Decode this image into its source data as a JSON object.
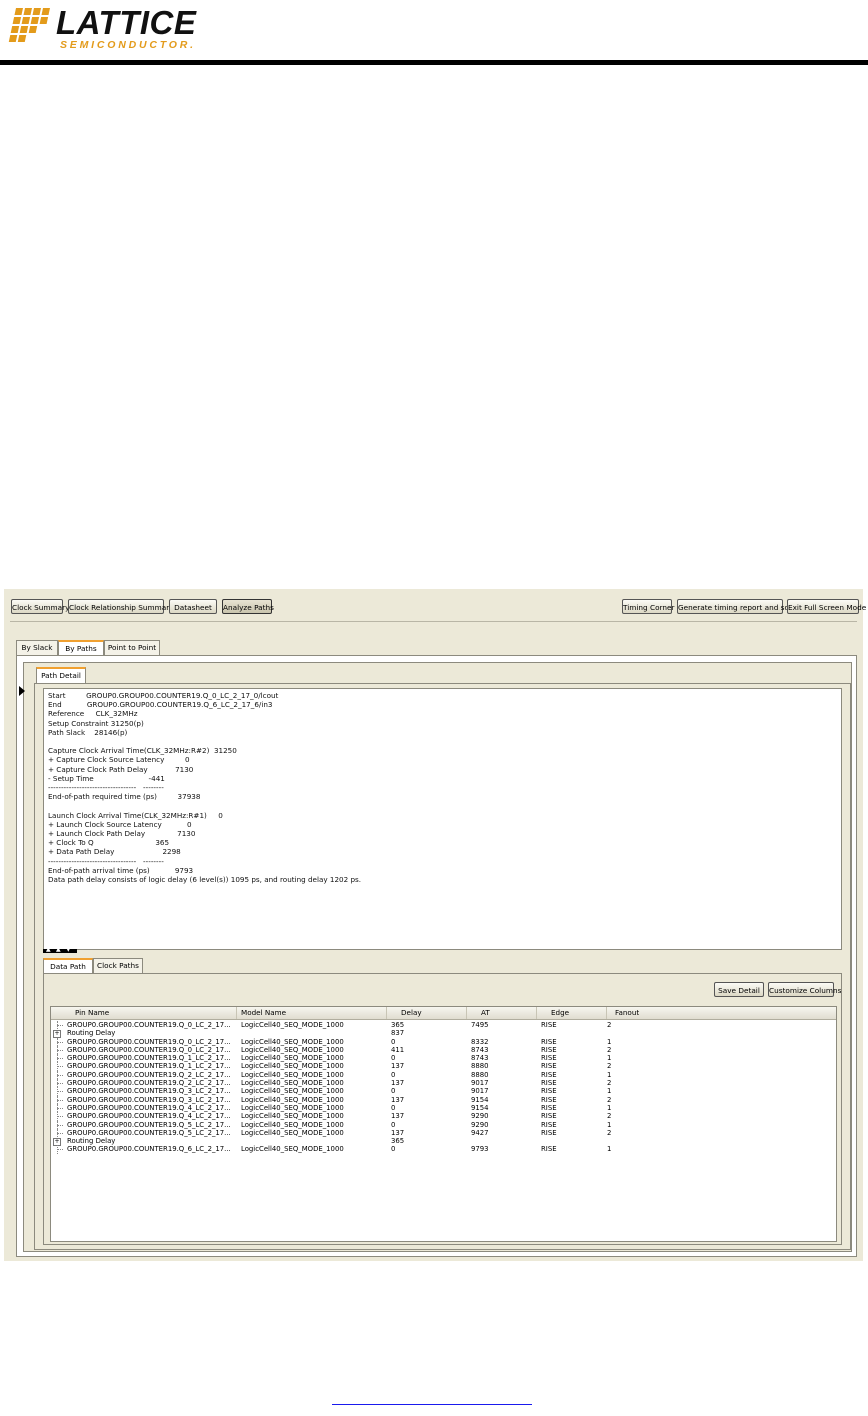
{
  "logo": {
    "word": "LATTICE",
    "sub": "SEMICONDUCTOR."
  },
  "toolbar": {
    "clock_summary": "Clock Summary",
    "clock_relationship_summary": "Clock Relationship Summary",
    "datasheet": "Datasheet",
    "analyze_paths": "Analyze Paths",
    "timing_corner": "Timing Corner",
    "generate_report": "Generate timing report and sdf",
    "exit_full_screen": "Exit Full Screen Mode"
  },
  "tabs": {
    "by_slack": "By Slack",
    "by_paths": "By Paths",
    "point_to_point": "Point to Point"
  },
  "path_detail_tab": "Path Detail",
  "detail": {
    "start_label": "Start",
    "start_value": "GROUP0.GROUP00.COUNTER19.Q_0_LC_2_17_0/lcout",
    "end_label": "End",
    "end_value": "GROUP0.GROUP00.COUNTER19.Q_6_LC_2_17_6/in3",
    "reference_label": "Reference",
    "reference_value": "CLK_32MHz",
    "setup_constraint": "Setup Constraint 31250(p)",
    "path_slack_label": "Path Slack",
    "path_slack_value": "28146(p)",
    "capture_arrival_label": "Capture Clock Arrival Time(CLK_32MHz:R#2)",
    "capture_arrival_value": "31250",
    "capture_source_latency_label": "+ Capture Clock Source Latency",
    "capture_source_latency_value": "0",
    "capture_path_delay_label": "+ Capture Clock Path Delay",
    "capture_path_delay_value": "7130",
    "setup_time_label": "- Setup Time",
    "setup_time_value": "-441",
    "dashes_a": "----------------------------------",
    "dashes_b": "--------",
    "required_time_label": "End-of-path required time (ps)",
    "required_time_value": "37938",
    "launch_arrival_label": "Launch Clock Arrival Time(CLK_32MHz:R#1)",
    "launch_arrival_value": "0",
    "launch_source_latency_label": "+ Launch Clock Source Latency",
    "launch_source_latency_value": "0",
    "launch_path_delay_label": "+ Launch Clock Path Delay",
    "launch_path_delay_value": "7130",
    "clock_to_q_label": "+ Clock To Q",
    "clock_to_q_value": "365",
    "data_path_delay_label": "+ Data Path Delay",
    "data_path_delay_value": "2298",
    "arrival_time_label": "End-of-path arrival time (ps)",
    "arrival_time_value": "9793",
    "summary": "Data path delay consists of logic delay (6 level(s)) 1095 ps, and routing delay 1202 ps."
  },
  "tabs2": {
    "data_path": "Data Path",
    "clock_paths": "Clock Paths"
  },
  "actions": {
    "save_detail": "Save Detail",
    "customize_columns": "Customize Columns"
  },
  "table": {
    "columns": [
      "Pin Name",
      "Model Name",
      "Delay",
      "AT",
      "Edge",
      "Fanout"
    ],
    "rows": [
      {
        "pin": "GROUP0.GROUP00.COUNTER19.Q_0_LC_2_17...",
        "model": "LogicCell40_SEQ_MODE_1000",
        "delay": "365",
        "at": "7495",
        "edge": "RISE",
        "fanout": "2",
        "expandable": false
      },
      {
        "pin": "Routing Delay",
        "model": "",
        "delay": "837",
        "at": "",
        "edge": "",
        "fanout": "",
        "expandable": true
      },
      {
        "pin": "GROUP0.GROUP00.COUNTER19.Q_0_LC_2_17...",
        "model": "LogicCell40_SEQ_MODE_1000",
        "delay": "0",
        "at": "8332",
        "edge": "RISE",
        "fanout": "1",
        "expandable": false
      },
      {
        "pin": "GROUP0.GROUP00.COUNTER19.Q_0_LC_2_17...",
        "model": "LogicCell40_SEQ_MODE_1000",
        "delay": "411",
        "at": "8743",
        "edge": "RISE",
        "fanout": "2",
        "expandable": false
      },
      {
        "pin": "GROUP0.GROUP00.COUNTER19.Q_1_LC_2_17...",
        "model": "LogicCell40_SEQ_MODE_1000",
        "delay": "0",
        "at": "8743",
        "edge": "RISE",
        "fanout": "1",
        "expandable": false
      },
      {
        "pin": "GROUP0.GROUP00.COUNTER19.Q_1_LC_2_17...",
        "model": "LogicCell40_SEQ_MODE_1000",
        "delay": "137",
        "at": "8880",
        "edge": "RISE",
        "fanout": "2",
        "expandable": false
      },
      {
        "pin": "GROUP0.GROUP00.COUNTER19.Q_2_LC_2_17...",
        "model": "LogicCell40_SEQ_MODE_1000",
        "delay": "0",
        "at": "8880",
        "edge": "RISE",
        "fanout": "1",
        "expandable": false
      },
      {
        "pin": "GROUP0.GROUP00.COUNTER19.Q_2_LC_2_17...",
        "model": "LogicCell40_SEQ_MODE_1000",
        "delay": "137",
        "at": "9017",
        "edge": "RISE",
        "fanout": "2",
        "expandable": false
      },
      {
        "pin": "GROUP0.GROUP00.COUNTER19.Q_3_LC_2_17...",
        "model": "LogicCell40_SEQ_MODE_1000",
        "delay": "0",
        "at": "9017",
        "edge": "RISE",
        "fanout": "1",
        "expandable": false
      },
      {
        "pin": "GROUP0.GROUP00.COUNTER19.Q_3_LC_2_17...",
        "model": "LogicCell40_SEQ_MODE_1000",
        "delay": "137",
        "at": "9154",
        "edge": "RISE",
        "fanout": "2",
        "expandable": false
      },
      {
        "pin": "GROUP0.GROUP00.COUNTER19.Q_4_LC_2_17...",
        "model": "LogicCell40_SEQ_MODE_1000",
        "delay": "0",
        "at": "9154",
        "edge": "RISE",
        "fanout": "1",
        "expandable": false
      },
      {
        "pin": "GROUP0.GROUP00.COUNTER19.Q_4_LC_2_17...",
        "model": "LogicCell40_SEQ_MODE_1000",
        "delay": "137",
        "at": "9290",
        "edge": "RISE",
        "fanout": "2",
        "expandable": false
      },
      {
        "pin": "GROUP0.GROUP00.COUNTER19.Q_5_LC_2_17...",
        "model": "LogicCell40_SEQ_MODE_1000",
        "delay": "0",
        "at": "9290",
        "edge": "RISE",
        "fanout": "1",
        "expandable": false
      },
      {
        "pin": "GROUP0.GROUP00.COUNTER19.Q_5_LC_2_17...",
        "model": "LogicCell40_SEQ_MODE_1000",
        "delay": "137",
        "at": "9427",
        "edge": "RISE",
        "fanout": "2",
        "expandable": false
      },
      {
        "pin": "Routing Delay",
        "model": "",
        "delay": "365",
        "at": "",
        "edge": "",
        "fanout": "",
        "expandable": true
      },
      {
        "pin": "GROUP0.GROUP00.COUNTER19.Q_6_LC_2_17...",
        "model": "LogicCell40_SEQ_MODE_1000",
        "delay": "0",
        "at": "9793",
        "edge": "RISE",
        "fanout": "1",
        "expandable": false
      }
    ]
  },
  "colors": {
    "logo_accent": "#e39b1b",
    "tab_highlight": "#f0a030",
    "panel_bg": "#ece9d8"
  }
}
